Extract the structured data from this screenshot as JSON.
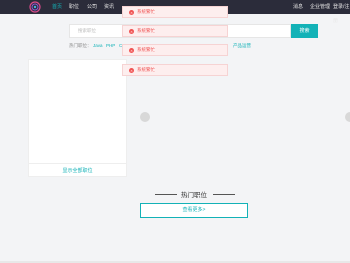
{
  "nav": {
    "items": [
      "首页",
      "职位",
      "公司",
      "资讯"
    ],
    "right": [
      "消息",
      "企业管理",
      "登录/注册"
    ]
  },
  "search": {
    "placeholder": "搜索职位",
    "button": "搜索",
    "hot_label": "热门职位：",
    "hot_tags": [
      "Java",
      "PHP",
      "C"
    ],
    "hot_extra": "产品运营"
  },
  "side": {
    "link": "显示全部职位"
  },
  "toasts": [
    "系统繁忙",
    "系统繁忙",
    "系统繁忙",
    "系统繁忙"
  ],
  "section": {
    "title": "热门职位",
    "more": "查看更多>"
  },
  "colors": {
    "accent": "#13b2b7",
    "topbar": "#2b2c3a",
    "error": "#f05454"
  }
}
